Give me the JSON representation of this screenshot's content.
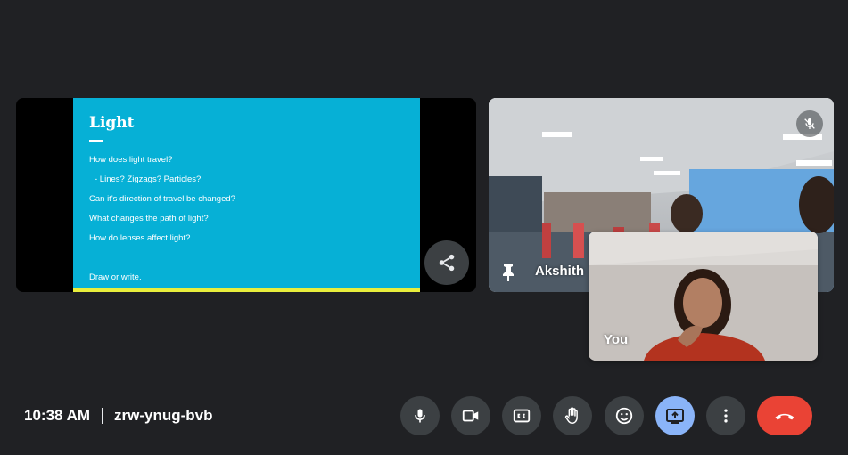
{
  "slide": {
    "title": "Light",
    "lines": [
      "How does light travel?",
      "-     Lines? Zigzags? Particles?",
      "Can it's direction of travel be changed?",
      "What changes the path of light?",
      "How do lenses affect light?"
    ],
    "footer": "Draw or write."
  },
  "participants": {
    "remote_name": "Akshith",
    "self_name": "You"
  },
  "meeting": {
    "time": "10:38 AM",
    "code": "zrw-ynug-bvb"
  },
  "controls": [
    {
      "icon": "mic-icon"
    },
    {
      "icon": "camera-icon"
    },
    {
      "icon": "captions-icon"
    },
    {
      "icon": "raise-hand-icon"
    },
    {
      "icon": "emoji-icon"
    },
    {
      "icon": "present-screen-icon"
    },
    {
      "icon": "more-options-icon"
    },
    {
      "icon": "end-call-icon"
    }
  ],
  "colors": {
    "background": "#202124",
    "slide_bg": "#06b0d6",
    "present_active": "#8ab4f8",
    "leave": "#ea4335"
  }
}
